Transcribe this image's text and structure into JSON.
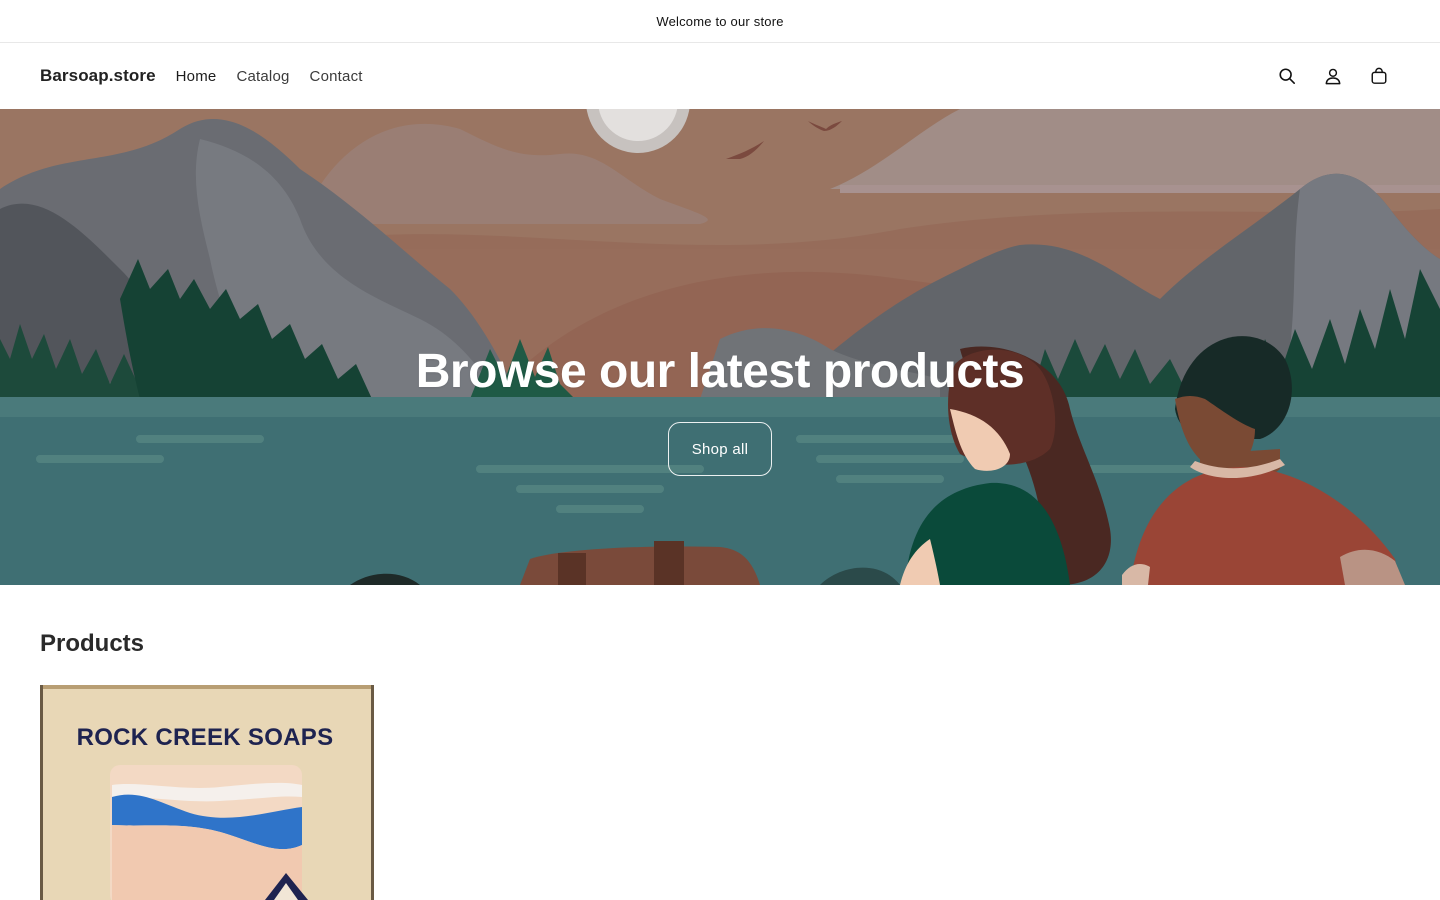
{
  "announcement": {
    "text": "Welcome to our store"
  },
  "header": {
    "logo": "Barsoap.store",
    "nav": [
      {
        "label": "Home"
      },
      {
        "label": "Catalog"
      },
      {
        "label": "Contact"
      }
    ],
    "icons": [
      "search-icon",
      "account-icon",
      "cart-icon"
    ]
  },
  "hero": {
    "title": "Browse our latest products",
    "button_label": "Shop all"
  },
  "products": {
    "title": "Products",
    "items": [
      {
        "image_text": "ROCK CREEK SOAPS"
      }
    ]
  },
  "colors": {
    "water": "#3f6f73",
    "sky": "#a07a63",
    "tree": "#1d4a3b",
    "mountain": "#5e6166",
    "box": "#e8d7b6",
    "soap_blue": "#2f74c9"
  }
}
